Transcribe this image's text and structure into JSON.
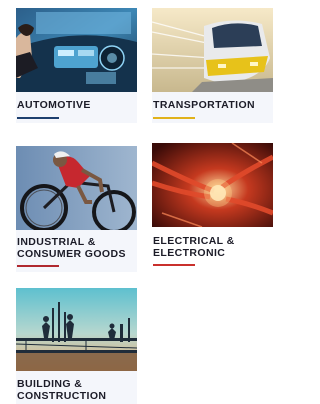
{
  "categories": [
    {
      "label": "AUTOMOTIVE",
      "accent": "#1d3f6e",
      "icon": "car-dashboard-image"
    },
    {
      "label": "TRANSPORTATION",
      "accent": "#e1b21a",
      "icon": "train-image"
    },
    {
      "label": "INDUSTRIAL & CONSUMER GOODS",
      "label_line1": "INDUSTRIAL &",
      "label_line2": "CONSUMER GOODS",
      "accent": "#b0292f",
      "icon": "cyclist-image"
    },
    {
      "label": "ELECTRICAL & ELECTRONIC",
      "label_line1": "ELECTRICAL &",
      "label_line2": "ELECTRONIC",
      "accent": "#c9302c",
      "icon": "electronic-cables-image"
    },
    {
      "label": "BUILDING & CONSTRUCTION",
      "label_line1": "BUILDING &",
      "label_line2": "CONSTRUCTION",
      "accent": "#1d3f6e",
      "icon": "construction-site-image"
    }
  ]
}
